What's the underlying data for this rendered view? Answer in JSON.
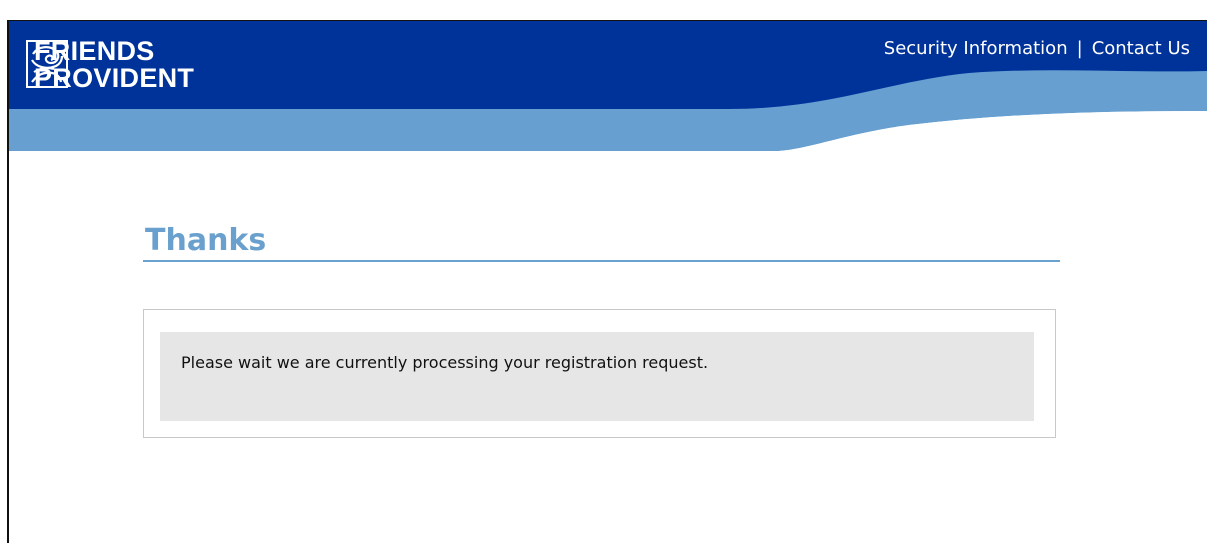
{
  "header": {
    "brand_line1": "FRIENDS",
    "brand_line2": "PROVIDENT",
    "links": {
      "security": "Security Information",
      "separator": "|",
      "contact": "Contact Us"
    },
    "colors": {
      "dark_blue": "#00339a",
      "light_blue": "#669fd0"
    },
    "logo_icon": "rose-logo-icon"
  },
  "main": {
    "title": "Thanks",
    "message": "Please wait we are currently processing your registration request."
  }
}
